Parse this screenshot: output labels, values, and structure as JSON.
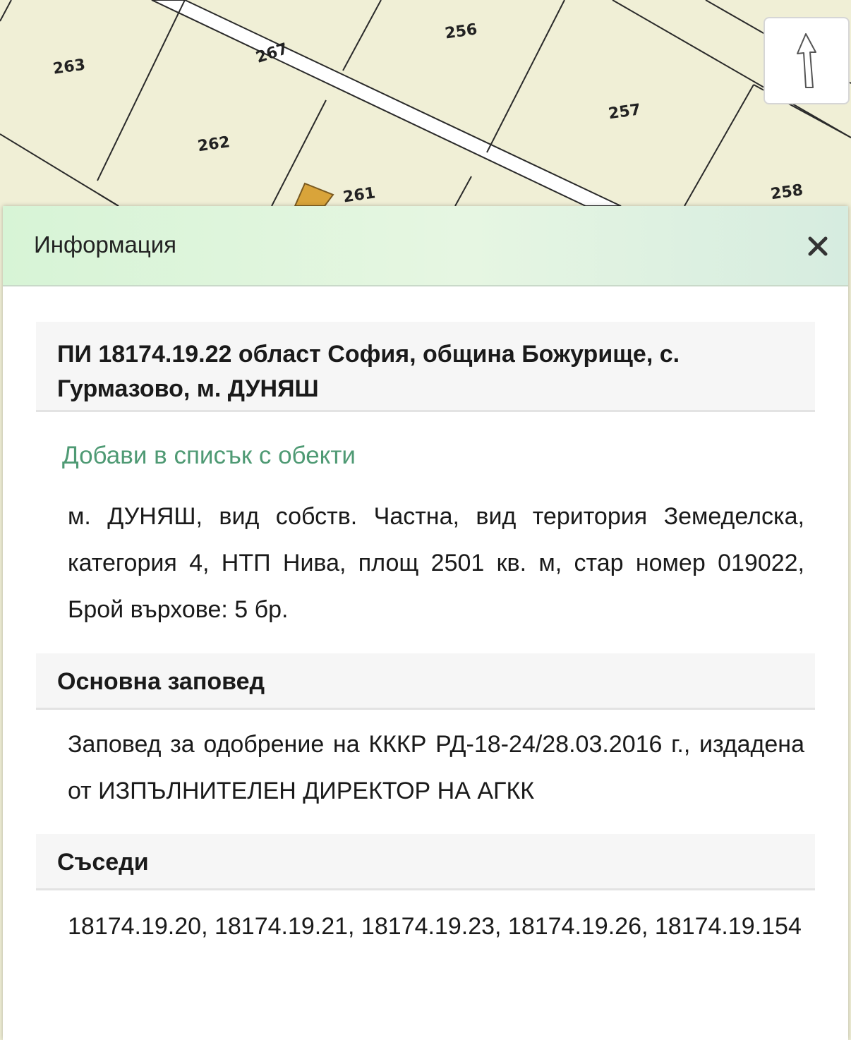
{
  "map": {
    "parcel_numbers": [
      "263",
      "267",
      "256",
      "257",
      "262",
      "261",
      "258"
    ]
  },
  "north_arrow": {
    "icon": "north-arrow-icon"
  },
  "panel": {
    "title": "Информация",
    "close_icon": "close-icon",
    "parcel": {
      "heading": "ПИ 18174.19.22 област София, община Божурище, с. Гурмазово, м. ДУНЯШ",
      "add_link": "Добави в списък с обекти",
      "details": "м. ДУНЯШ, вид собств. Частна, вид територия Земеделска, категория 4, НТП Нива, площ 2501 кв. м, стар номер 019022, Брой върхове: 5 бр."
    },
    "basic_order": {
      "heading": "Основна заповед",
      "text": "Заповед за одобрение на КККР РД-18-24/28.03.2016 г., издадена от ИЗПЪЛНИТЕЛЕН ДИРЕКТОР НА АГКК"
    },
    "neighbors": {
      "heading": "Съседи",
      "text": "18174.19.20, 18174.19.21, 18174.19.23, 18174.19.26, 18174.19.154"
    }
  },
  "colors": {
    "map_background": "#f0efd6",
    "parcel_lines": "#2a2a2a",
    "building": "#d9a43a",
    "link": "#4f9a74",
    "header_gradient_start": "#d7f4d6"
  }
}
